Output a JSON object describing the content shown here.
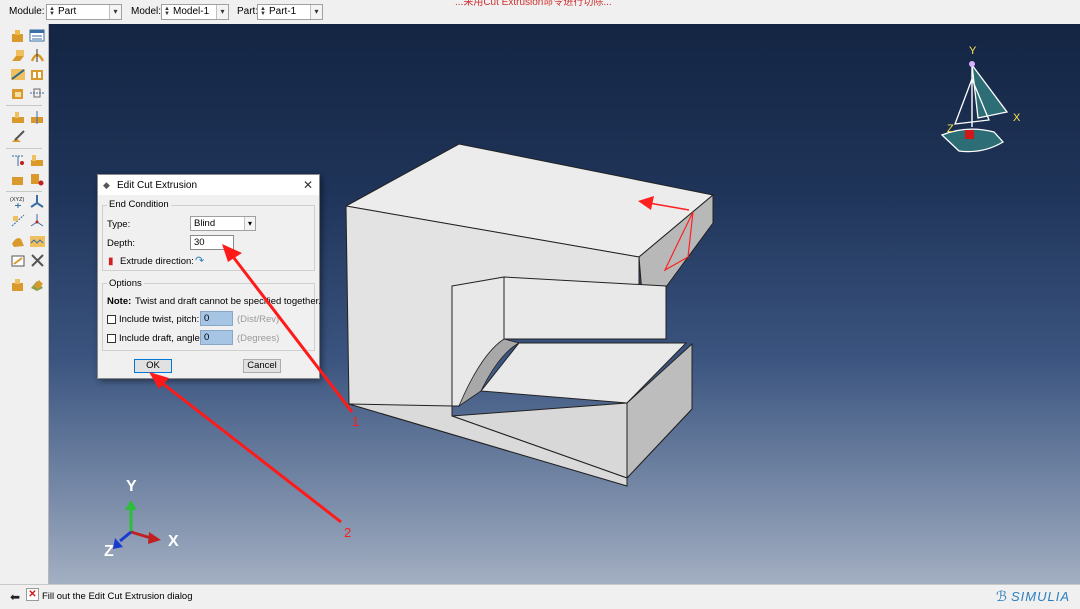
{
  "top_toolbar": {
    "module_label": "Module:",
    "module_value": "Part",
    "model_label": "Model:",
    "model_value": "Model-1",
    "part_label": "Part:",
    "part_value": "Part-1",
    "partial_red_text": "...采用Cut Extrusion命令进行切除..."
  },
  "dialog": {
    "title": "Edit Cut Extrusion",
    "end_condition_label": "End Condition",
    "type_label": "Type:",
    "type_value": "Blind",
    "depth_label": "Depth:",
    "depth_value": "30",
    "extrude_direction_label": "Extrude direction:",
    "options_label": "Options",
    "note_bold": "Note:",
    "note_text": "Twist and draft cannot be specified together.",
    "twist_label": "Include twist, pitch:",
    "twist_value": "0",
    "twist_unit": "(Dist/Rev)",
    "draft_label": "Include draft, angle:",
    "draft_value": "0",
    "draft_unit": "(Degrees)",
    "ok_label": "OK",
    "cancel_label": "Cancel"
  },
  "triad": {
    "x_label": "X",
    "y_label": "Y",
    "z_label": "Z"
  },
  "view_cube": {
    "x_label": "X",
    "y_label": "Y",
    "z_label": "Z"
  },
  "annotations": {
    "arrow1_label": "1",
    "arrow2_label": "2"
  },
  "status_bar": {
    "message": "Fill out the Edit Cut Extrusion dialog",
    "brand": "SIMULIA"
  },
  "colors": {
    "annotation_red": "#ff1a1a",
    "triad_y": "#2ebd3a",
    "triad_x": "#c02020",
    "triad_z": "#1a3bd0",
    "viewcube_teal": "#2d6e76",
    "part_face": "#e3e3e3"
  },
  "icons": {
    "toolbox": [
      "create-part-icon",
      "part-manager-icon",
      "extrude-solid-icon",
      "revolve-solid-icon",
      "cut-extrude-icon",
      "sweep-solid-icon",
      "shell-icon",
      "blend-icon",
      "datum-icon",
      "partition-icon",
      "set-icon",
      "surface-icon",
      "xyz-point-icon",
      "datum-axis-icon",
      "datum-plane-icon",
      "datum-csys-icon",
      "repair-icon",
      "wire-icon",
      "query-icon",
      "tools-icon",
      "feature-manager-icon",
      "part-copy-icon"
    ]
  }
}
